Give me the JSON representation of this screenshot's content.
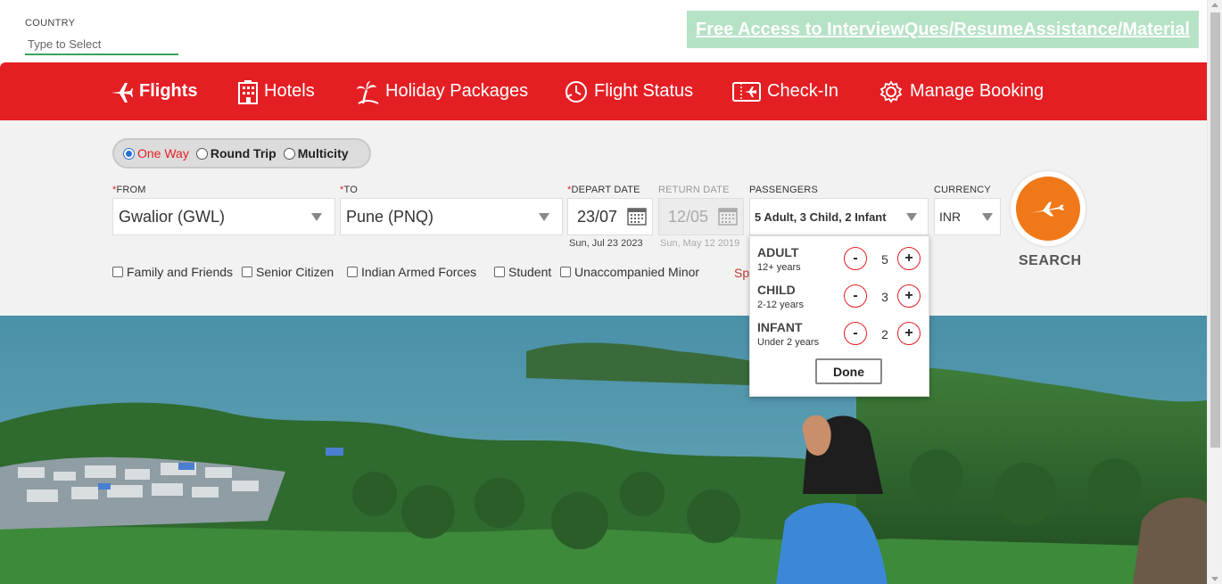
{
  "country": {
    "label": "COUNTRY",
    "placeholder": "Type to Select"
  },
  "promo": {
    "text": "Free Access to InterviewQues/ResumeAssistance/Material"
  },
  "nav": {
    "items": [
      {
        "label": "Flights",
        "icon": "plane-icon",
        "active": true
      },
      {
        "label": "Hotels",
        "icon": "building-icon"
      },
      {
        "label": "Holiday Packages",
        "icon": "palm-tree-icon"
      },
      {
        "label": "Flight Status",
        "icon": "clock-icon"
      },
      {
        "label": "Check-In",
        "icon": "ticket-icon"
      },
      {
        "label": "Manage Booking",
        "icon": "gear-icon"
      }
    ]
  },
  "trip": {
    "options": [
      {
        "label": "One Way",
        "selected": true
      },
      {
        "label": "Round Trip",
        "selected": false
      },
      {
        "label": "Multicity",
        "selected": false
      }
    ]
  },
  "form": {
    "from": {
      "label": "FROM",
      "value": "Gwalior (GWL)"
    },
    "to": {
      "label": "TO",
      "value": "Pune (PNQ)"
    },
    "depart": {
      "label": "DEPART DATE",
      "value": "23/07",
      "sub": "Sun, Jul 23 2023"
    },
    "return": {
      "label": "RETURN DATE",
      "value": "12/05",
      "sub": "Sun, May 12 2019"
    },
    "passengers": {
      "label": "PASSENGERS",
      "value": "5 Adult, 3 Child, 2 Infant"
    },
    "currency": {
      "label": "CURRENCY",
      "value": "INR"
    },
    "search_label": "SEARCH"
  },
  "checkboxes": [
    {
      "label": "Family and Friends"
    },
    {
      "label": "Senior Citizen"
    },
    {
      "label": "Indian Armed Forces"
    },
    {
      "label": "Student"
    },
    {
      "label": "Unaccompanied Minor"
    }
  ],
  "special_text": "Sp",
  "pax_popup": {
    "adult": {
      "title": "ADULT",
      "sub": "12+ years",
      "count": "5"
    },
    "child": {
      "title": "CHILD",
      "sub": "2-12 years",
      "count": "3"
    },
    "infant": {
      "title": "INFANT",
      "sub": "Under 2 years",
      "count": "2"
    },
    "minus": "-",
    "plus": "+",
    "done": "Done"
  },
  "colors": {
    "brand_red": "#e41f24",
    "search_orange": "#f07818",
    "promo_green": "#b6e2c6"
  }
}
